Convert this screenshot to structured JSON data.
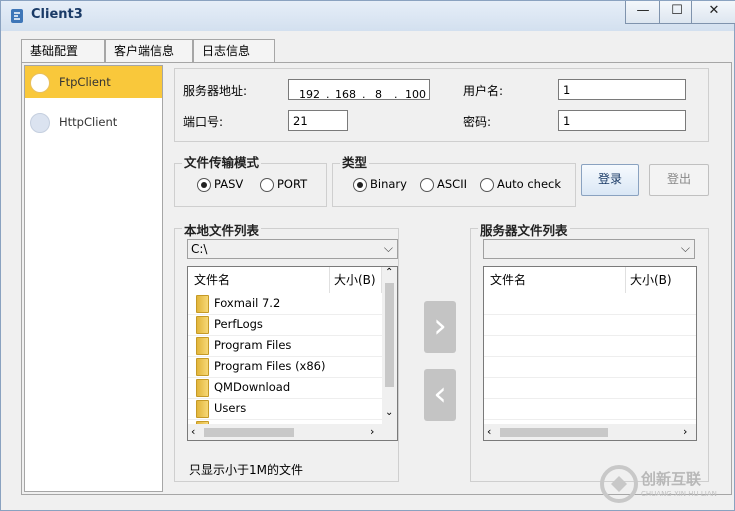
{
  "window": {
    "title": "Client3",
    "min_icon": "minimize-icon",
    "max_icon": "maximize-icon",
    "close_icon": "close-icon"
  },
  "tabs": [
    {
      "label": "基础配置"
    },
    {
      "label": "客户端信息"
    },
    {
      "label": "日志信息"
    }
  ],
  "sidebar": {
    "items": [
      {
        "label": "FtpClient"
      },
      {
        "label": "HttpClient"
      }
    ]
  },
  "server": {
    "address_label": "服务器地址:",
    "ip": [
      "192",
      "168",
      "8",
      "100"
    ],
    "port_label": "端口号:",
    "port_value": "21",
    "username_label": "用户名:",
    "username_value": "1",
    "password_label": "密码:",
    "password_value": "1"
  },
  "transfer_mode": {
    "title": "文件传输模式",
    "options": [
      "PASV",
      "PORT"
    ],
    "selected": "PASV"
  },
  "type": {
    "title": "类型",
    "options": [
      "Binary",
      "ASCII",
      "Auto check"
    ],
    "selected": "Binary"
  },
  "buttons": {
    "login": "登录",
    "logout": "登出"
  },
  "local_files": {
    "title": "本地文件列表",
    "path": "C:\\",
    "columns": [
      "文件名",
      "大小(B)"
    ],
    "rows": [
      "Foxmail 7.2",
      "PerfLogs",
      "Program Files",
      "Program Files (x86)",
      "QMDownload",
      "Users"
    ]
  },
  "server_files": {
    "title": "服务器文件列表",
    "path": "",
    "columns": [
      "文件名",
      "大小(B)"
    ],
    "rows": []
  },
  "footer_note": "只显示小于1M的文件",
  "watermark": {
    "title": "创新互联",
    "subtitle": "CHUANG XIN HU LIAN"
  }
}
